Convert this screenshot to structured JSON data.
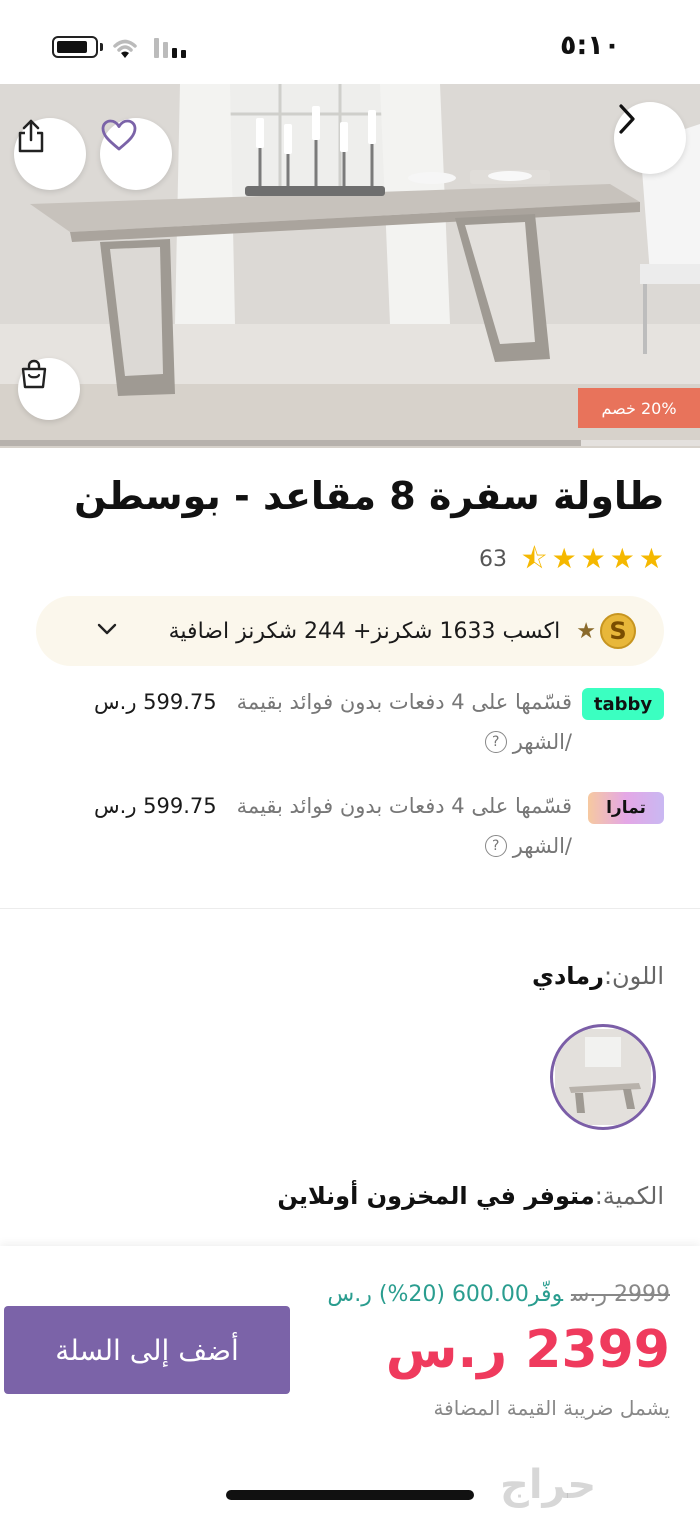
{
  "status_bar": {
    "time": "٥:١٠"
  },
  "hero": {
    "discount_badge": "20% خصم",
    "image_progress": 0.83
  },
  "product": {
    "title": "طاولة سفرة 8 مقاعد - بوسطن",
    "rating": 4.5,
    "rating_count": "63"
  },
  "reward": {
    "coin_letter": "S",
    "text": "اكسب 1633 شكرنز+  244 شكرنز اضافية"
  },
  "installments": [
    {
      "logo": "tabby",
      "text": "قسّمها على 4 دفعات بدون فوائد بقيمة",
      "amount": "599.75 ر.س",
      "period": "/الشهر"
    },
    {
      "logo": "تمارا",
      "text": "قسّمها على 4 دفعات بدون فوائد بقيمة",
      "amount": "599.75 ر.س",
      "period": "/الشهر"
    }
  ],
  "options": {
    "color_label": "اللون:",
    "color_value": "رمادي",
    "quantity_label": "الكمية:",
    "quantity_value": "متوفر في المخزون أونلاين"
  },
  "pricing": {
    "old_price": "2999 ر.س",
    "savings": "وفّر600.00 (20%) ر.س",
    "price": "2399 ر.س",
    "vat_note": "يشمل ضريبة القيمة المضافة"
  },
  "cart": {
    "add_label": "أضف إلى السلة"
  },
  "watermark": "حراج",
  "colors": {
    "accent": "#7b63a8",
    "price_red": "#ef3a5d",
    "savings_green": "#2a9d8f",
    "discount_orange": "#e8735b",
    "tabby_green": "#3bffc1"
  }
}
